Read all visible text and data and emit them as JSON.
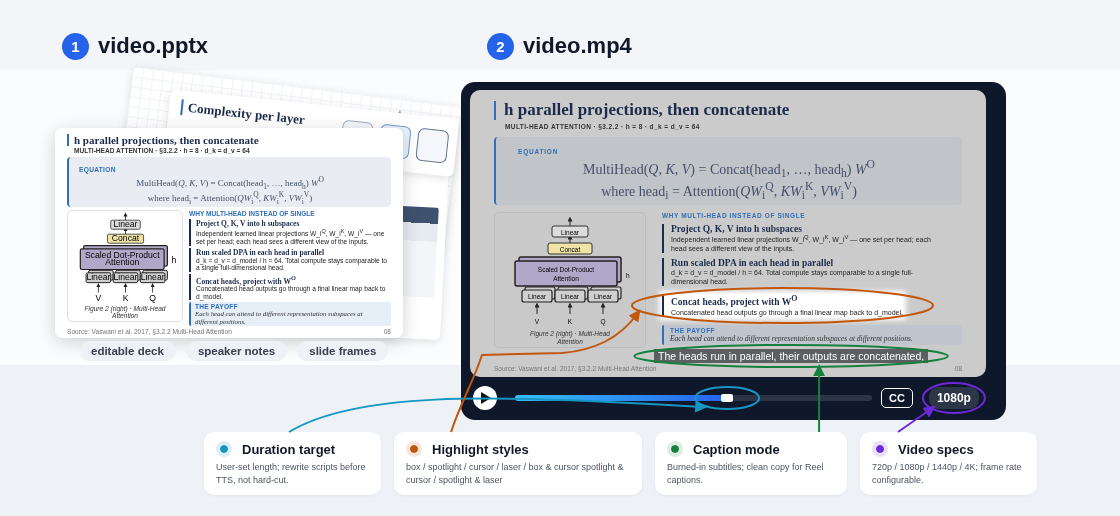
{
  "steps": [
    {
      "number": "1",
      "title": "video.pptx"
    },
    {
      "number": "2",
      "title": "video.mp4"
    }
  ],
  "deck": {
    "back_slides": [
      {
        "title": "Complexity per layer"
      }
    ],
    "slide": {
      "title": "h parallel projections, then concatenate",
      "subtitle": "MULTI-HEAD ATTENTION · §3.2.2 · h = 8 · d_k = d_v = 64",
      "equation": {
        "label": "EQUATION",
        "lines": [
          "MultiHead(*Q*, *K*, *V*) = Concat(head$_{1}$, …, head$_{h}$) *W*$^{O}$",
          "where head$_{i}$ = Attention(*QW*$_{i}$$^{Q}$, *KW*$_{i}$$^{K}$, *VW*$_{i}$$^{V}$)"
        ]
      },
      "figure": {
        "output": "Linear",
        "concat": "Concat",
        "attention": [
          "Scaled Dot-Product",
          "Attention"
        ],
        "heads": "h",
        "inputs": [
          {
            "label": "V",
            "layer": "Linear"
          },
          {
            "label": "K",
            "layer": "Linear"
          },
          {
            "label": "Q",
            "layer": "Linear"
          }
        ],
        "caption": "Figure 2 (right) · Multi-Head Attention"
      },
      "section_label": "WHY MULTI-HEAD INSTEAD OF SINGLE",
      "points": [
        {
          "heading": "Project Q, K, V into h subspaces",
          "body": "Independent learned linear projections W_i$^{Q}$, W_i$^{K}$, W_i$^{V}$ — one set per head; each head sees a different view of the inputs."
        },
        {
          "heading": "Run scaled DPA in each head in parallel",
          "body": "d_k = d_v = d_model / h = 64. Total compute stays comparable to a single full-dimensional head."
        },
        {
          "heading": "Concat heads, project with W$^{O}$",
          "body": "Concatenated head outputs go through a final linear map back to d_model."
        }
      ],
      "payoff": {
        "label": "THE PAYOFF",
        "text": "Each head can attend to different representation subspaces at different positions."
      },
      "source": "Source: Vaswani et al. 2017, §3.2.2 Multi-Head Attention",
      "page": "08"
    },
    "tags": [
      "editable deck",
      "speaker notes",
      "slide frames"
    ]
  },
  "video": {
    "slide": {
      "dimmed": true,
      "title": "h parallel projections, then concatenate",
      "subtitle": "MULTI-HEAD ATTENTION · §3.2.2 · h = 8 · d_k = d_v = 64",
      "equation": {
        "label": "EQUATION",
        "lines": [
          "MultiHead(*Q*, *K*, *V*) = Concat(head$_{1}$, …, head$_{h}$) *W*$^{O}$",
          "where head$_{i}$ = Attention(*QW*$_{i}$$^{Q}$, *KW*$_{i}$$^{K}$, *VW*$_{i}$$^{V}$)"
        ]
      },
      "figure": {
        "output": "Linear",
        "concat": "Concat",
        "attention": [
          "Scaled Dot-Product",
          "Attention"
        ],
        "heads": "h",
        "inputs": [
          {
            "label": "V",
            "layer": "Linear"
          },
          {
            "label": "K",
            "layer": "Linear"
          },
          {
            "label": "Q",
            "layer": "Linear"
          }
        ],
        "caption": "Figure 2 (right) · Multi-Head Attention"
      },
      "section_label": "WHY MULTI-HEAD INSTEAD OF SINGLE",
      "points": [
        {
          "heading": "Project Q, K, V into h subspaces",
          "body": "Independent learned linear projections W_i$^{Q}$, W_i$^{K}$, W_i$^{V}$ — one set per head; each head sees a different view of the inputs.",
          "highlighted": false
        },
        {
          "heading": "Run scaled DPA in each head in parallel",
          "body": "d_k = d_v = d_model / h = 64. Total compute stays comparable to a single full-dimensional head.",
          "highlighted": false
        },
        {
          "heading": "Concat heads, project with W$^{O}$",
          "body": "Concatenated head outputs go through a final linear map back to d_model.",
          "highlighted": true
        }
      ],
      "payoff": {
        "label": "THE PAYOFF",
        "text": "Each head can attend to different representation subspaces at different positions."
      },
      "source": "Source: Vaswani et al. 2017, §3.2.2 Multi-Head Attention",
      "page": "08"
    },
    "subtitle": "The heads run in parallel, their outputs are concatenated,",
    "player": {
      "playing": false,
      "level": 0.6,
      "cc": "CC",
      "quality": "1080p"
    }
  },
  "features": [
    {
      "title": "Duration target",
      "description": "User-set length; rewrite scripts before TTS, not hard-cut.",
      "color": "#1596c4"
    },
    {
      "title": "Highlight styles",
      "description": "box / spotlight / cursor / laser / box & cursor spotlight & cursor / spotlight & laser",
      "color": "#c2570c"
    },
    {
      "title": "Caption mode",
      "description": "Burned-in subtitles; clean copy for Reel captions.",
      "color": "#15803d"
    },
    {
      "title": "Video specs",
      "description": "720p / 1080p / 1440p / 4K; frame rate configurable.",
      "color": "#6d28d9"
    }
  ]
}
